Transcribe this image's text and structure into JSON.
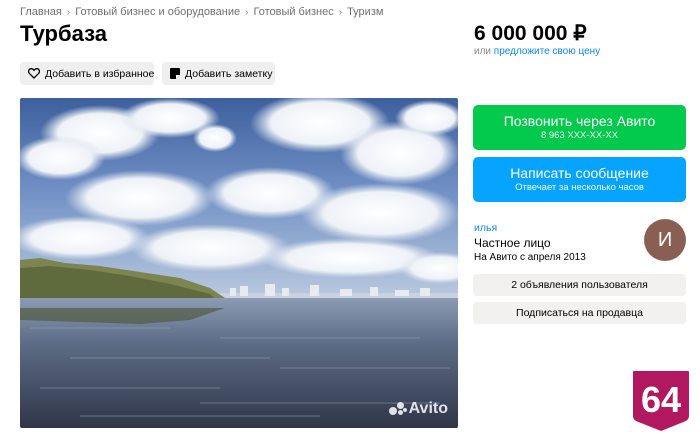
{
  "breadcrumb": [
    "Главная",
    "Готовый бизнес и оборудование",
    "Готовый бизнес",
    "Туризм"
  ],
  "title": "Турбаза",
  "price": {
    "value": "6 000 000 ₽",
    "or": "или",
    "suggest": "предложите свою цену"
  },
  "actions": {
    "favorite": "Добавить в избранное",
    "note": "Добавить заметку"
  },
  "photo": {
    "watermark": "Avito"
  },
  "call": {
    "label": "Позвонить через Авито",
    "phone": "8 963 XXX-XX-XX"
  },
  "message": {
    "label": "Написать сообщение",
    "sub": "Отвечает за несколько часов"
  },
  "seller": {
    "name": "илья",
    "type": "Частное лицо",
    "since": "На Авито с апреля 2013",
    "avatar_letter": "И",
    "avatar_color": "#8a5f53"
  },
  "seller_ads": "2 объявления пользователя",
  "subscribe": "Подписаться на продавца",
  "badge": {
    "number": "64",
    "color": "#b2185f"
  },
  "colors": {
    "call_button": "#03c94c",
    "message_button": "#07a4ff",
    "link": "#0a88ff"
  }
}
